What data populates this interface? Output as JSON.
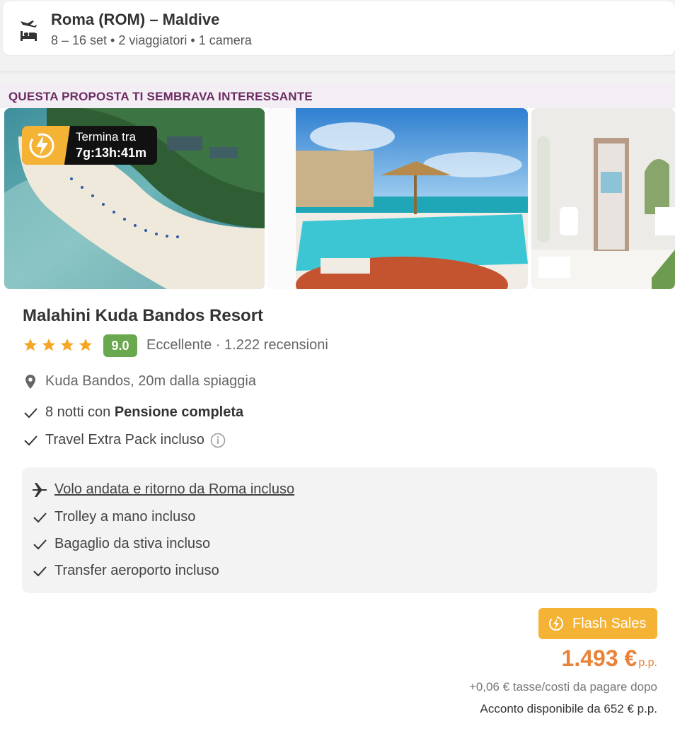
{
  "search": {
    "title": "Roma (ROM) – Maldive",
    "details": "8 – 16 set • 2 viaggiatori • 1 camera"
  },
  "card": {
    "header": "QUESTA PROPOSTA TI SEMBRAVA INTERESSANTE",
    "timer": {
      "label": "Termina tra",
      "value": "7g:13h:41m"
    },
    "hotel_name": "Malahini Kuda Bandos Resort",
    "stars": 4,
    "rating": "9.0",
    "reviews": "Eccellente · 1.222 recensioni",
    "location": "Kuda Bandos, 20m dalla spiaggia",
    "nights": "8 notti con ",
    "board": "Pensione completa",
    "extra_pack": "Travel Extra Pack incluso",
    "flight": {
      "title": "Volo andata e ritorno da Roma incluso",
      "items": [
        "Trolley a mano incluso",
        "Bagaglio da stiva incluso",
        "Transfer aeroporto incluso"
      ]
    },
    "badge": "Flash Sales",
    "price": "1.493 €",
    "price_unit": "p.p.",
    "taxes": "+0,06 € tasse/costi da pagare dopo",
    "deposit": "Acconto disponibile da 652 € p.p."
  },
  "colors": {
    "accent": "#f5b335",
    "price": "#e8843a",
    "header_text": "#6b2b63",
    "rating_bg": "#6aa84f"
  },
  "icons": [
    "flight-hotel-icon",
    "lightning-icon",
    "star-icon",
    "location-pin-icon",
    "check-icon",
    "info-icon",
    "plane-icon"
  ]
}
